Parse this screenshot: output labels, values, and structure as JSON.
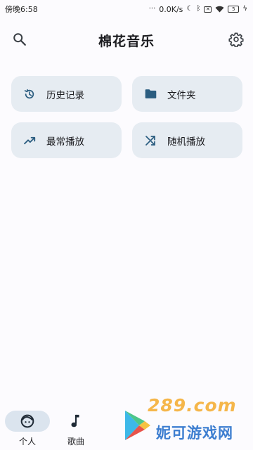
{
  "status_bar": {
    "time": "傍晚6:58",
    "net_speed": "0.0K/s",
    "battery": "5"
  },
  "app_bar": {
    "title": "棉花音乐",
    "search_icon": "search-icon",
    "settings_icon": "gear-icon"
  },
  "tiles": [
    {
      "label": "历史记录",
      "icon": "history-icon"
    },
    {
      "label": "文件夹",
      "icon": "folder-icon"
    },
    {
      "label": "最常播放",
      "icon": "trending-up-icon"
    },
    {
      "label": "随机播放",
      "icon": "shuffle-icon"
    }
  ],
  "bottom_nav": {
    "items": [
      {
        "label": "个人",
        "icon": "face-icon",
        "selected": true
      },
      {
        "label": "歌曲",
        "icon": "music-note-icon",
        "selected": false
      }
    ]
  },
  "watermark": {
    "site": "289.com",
    "name": "妮可游戏网"
  },
  "colors": {
    "background": "#fcfbfe",
    "tile_background": "#e6ecf2",
    "icon_accent": "#2b5d80",
    "nav_selected_pill": "#dbe4ee"
  }
}
